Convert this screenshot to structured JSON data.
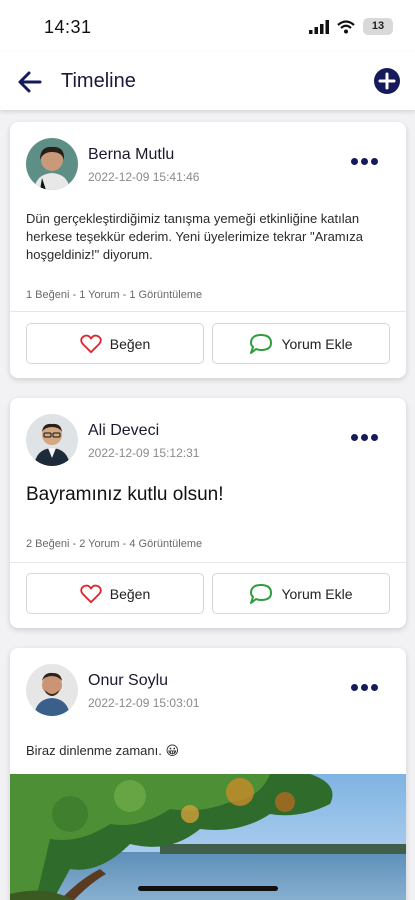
{
  "status_bar": {
    "time": "14:31",
    "battery": "13",
    "icons": [
      "signal-icon",
      "wifi-icon",
      "battery-icon"
    ]
  },
  "app_bar": {
    "title": "Timeline",
    "back_icon": "arrow-left-icon",
    "add_icon": "plus-circle-icon",
    "accent_color": "#141a5a"
  },
  "posts": [
    {
      "author": "Berna Mutlu",
      "timestamp": "2022-12-09 15:41:46",
      "text": "Dün gerçekleştirdiğimiz tanışma yemeği etkinliğine katılan herkese teşekkür ederim. Yeni üyelerimize tekrar \"Aramıza hoşgeldiniz!\" diyorum.",
      "stats": "1 Beğeni - 1 Yorum - 1 Görüntüleme",
      "like_label": "Beğen",
      "comment_label": "Yorum Ekle"
    },
    {
      "author": "Ali Deveci",
      "timestamp": "2022-12-09 15:12:31",
      "text": "Bayramınız kutlu olsun!",
      "stats": "2 Beğeni - 2 Yorum - 4 Görüntüleme",
      "like_label": "Beğen",
      "comment_label": "Yorum Ekle"
    },
    {
      "author": "Onur Soylu",
      "timestamp": "2022-12-09 15:03:01",
      "text": "Biraz dinlenme zamanı. 😀"
    }
  ],
  "colors": {
    "like_heart": "#e0242c",
    "comment_bubble": "#2e9e3e",
    "more_dots": "#141a5a"
  }
}
